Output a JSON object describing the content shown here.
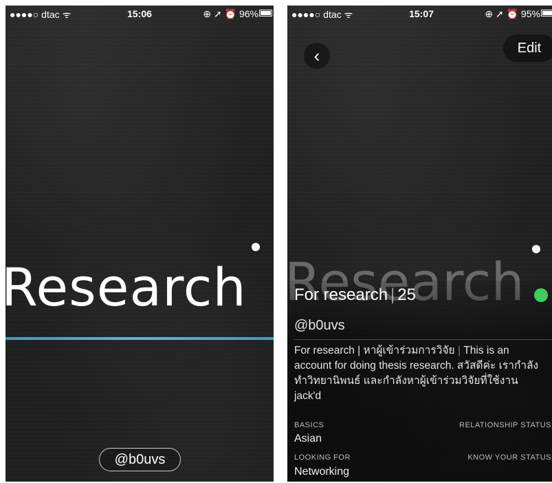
{
  "left_screen": {
    "status": {
      "carrier": "●●●●○ dtac ᯤ",
      "time": "15:06",
      "indicators": "⊕ ➚ ⏰ 96%"
    },
    "cover_text": "Research",
    "username_pill": "@b0uvs"
  },
  "right_screen": {
    "status": {
      "carrier": "●●●●○ dtac ᯤ",
      "time": "15:07",
      "indicators": "⊕ ➚ ⏰ 95%"
    },
    "back_label": "‹",
    "edit_label": "Edit",
    "cover_text": "Research",
    "profile": {
      "display_name": "For research",
      "age": "25",
      "online_color": "#3ccd5c",
      "username": "@b0uvs",
      "bio_part1": "For research | หาผู้เข้าร่วมการวิจัย",
      "bio_sep": "|",
      "bio_part2": "This is an account for doing thesis research. สวัสดีค่ะ เรากำลังทำวิทยานิพนธ์ และกำลังหาผู้เข้าร่วมวิจัยที่ใช้งาน jack'd",
      "basics_label": "BASICS",
      "basics_value": "Asian",
      "relationship_label": "RELATIONSHIP STATUS",
      "looking_label": "LOOKING FOR",
      "looking_value": "Networking",
      "know_status_label": "KNOW YOUR STATUS"
    }
  }
}
